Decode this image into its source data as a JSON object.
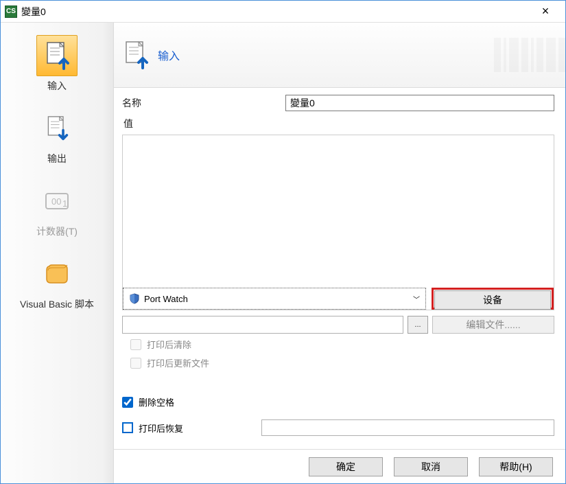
{
  "window": {
    "title": "變量0"
  },
  "sidebar": {
    "items": [
      {
        "label": "输入",
        "key": "input"
      },
      {
        "label": "输出",
        "key": "output"
      },
      {
        "label": "计数器(T)",
        "key": "counter"
      },
      {
        "label": "Visual Basic 脚本",
        "key": "vbs"
      }
    ]
  },
  "header": {
    "title": "输入"
  },
  "form": {
    "name_label": "名称",
    "name_value": "變量0",
    "value_label": "值",
    "value_text": "",
    "source_selected": "Port Watch",
    "device_button": "设备",
    "file_path": "",
    "browse_label": "...",
    "edit_file_label": "编辑文件......",
    "checks": {
      "clear_after_print": "打印后清除",
      "update_after_print": "打印后更新文件",
      "delete_space": "删除空格",
      "restore_after_print": "打印后恢复"
    },
    "restore_value": ""
  },
  "buttons": {
    "ok": "确定",
    "cancel": "取消",
    "help": "帮助(H)"
  },
  "state": {
    "clear_after_print": false,
    "update_after_print": false,
    "delete_space": true,
    "restore_after_print": false
  },
  "icons": {
    "app": "CS",
    "close": "×"
  }
}
